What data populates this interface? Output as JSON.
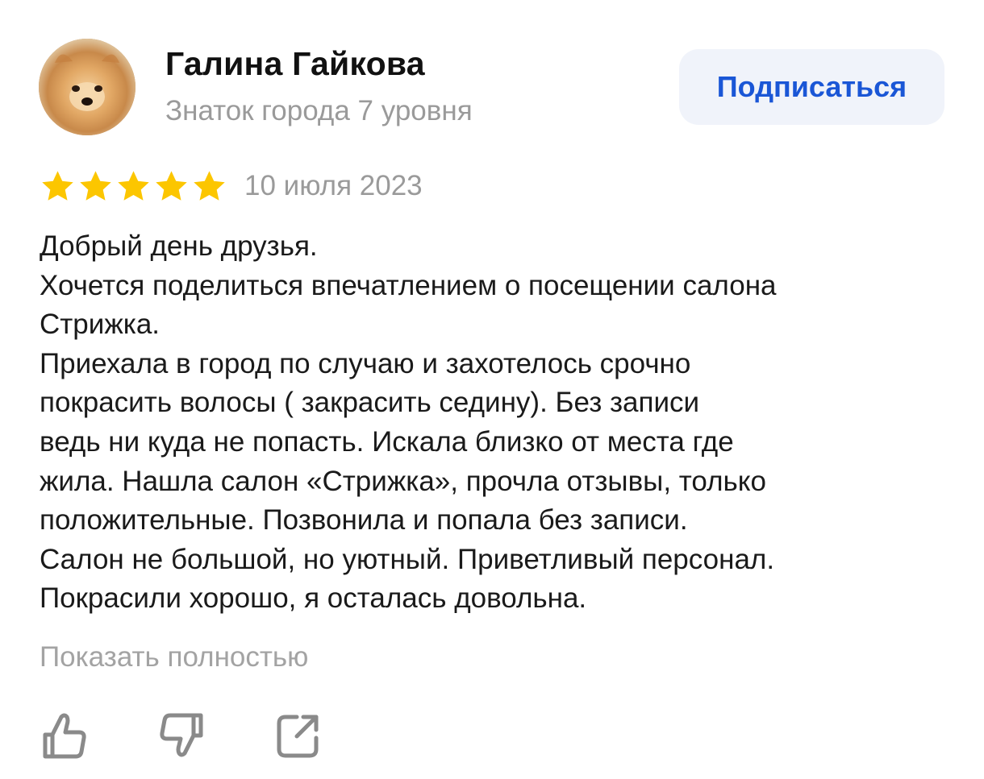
{
  "author": {
    "name": "Галина Гайкова",
    "level": "Знаток города 7 уровня",
    "avatar_icon": "pomeranian-dog-avatar"
  },
  "subscribe": {
    "label": "Подписаться"
  },
  "review": {
    "rating": 5,
    "rating_max": 5,
    "star_color": "#fcc600",
    "date": "10 июля 2023",
    "lines": [
      "Добрый день друзья.",
      "Хочется поделиться впечатлением о посещении салона",
      "Стрижка.",
      "Приехала в город по случаю и захотелось срочно",
      "покрасить волосы ( закрасить седину). Без записи",
      "ведь ни куда не попасть. Искала близко от места где",
      "жила. Нашла салон «Стрижка», прочла отзывы, только",
      "положительные. Позвонила и попала без записи.",
      "Салон не большой, но уютный. Приветливый персонал.",
      "Покрасили хорошо, я осталась довольна."
    ],
    "show_more": "Показать полностью"
  },
  "actions": {
    "like_icon": "thumbs-up-icon",
    "dislike_icon": "thumbs-down-icon",
    "share_icon": "share-icon"
  },
  "colors": {
    "accent": "#1a56d6",
    "button_bg": "#f0f3fa",
    "muted_text": "#9a9a9a",
    "icon_gray": "#8a8a8a"
  }
}
